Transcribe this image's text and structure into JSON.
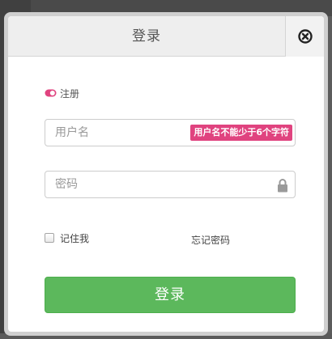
{
  "modal": {
    "title": "登录",
    "close_icon": "close-circle-icon"
  },
  "mode_toggle": {
    "icon": "toggle-icon",
    "label": "注册",
    "color": "#e0437f"
  },
  "username": {
    "placeholder": "用户名",
    "value": "",
    "error_message": "用户名不能少于6个字符"
  },
  "password": {
    "placeholder": "密码",
    "value": "",
    "icon": "lock-icon"
  },
  "remember_me": {
    "label": "记住我",
    "checked": false
  },
  "forgot_password": {
    "label": "忘记密码"
  },
  "submit": {
    "label": "登录",
    "color": "#5cb85c"
  }
}
